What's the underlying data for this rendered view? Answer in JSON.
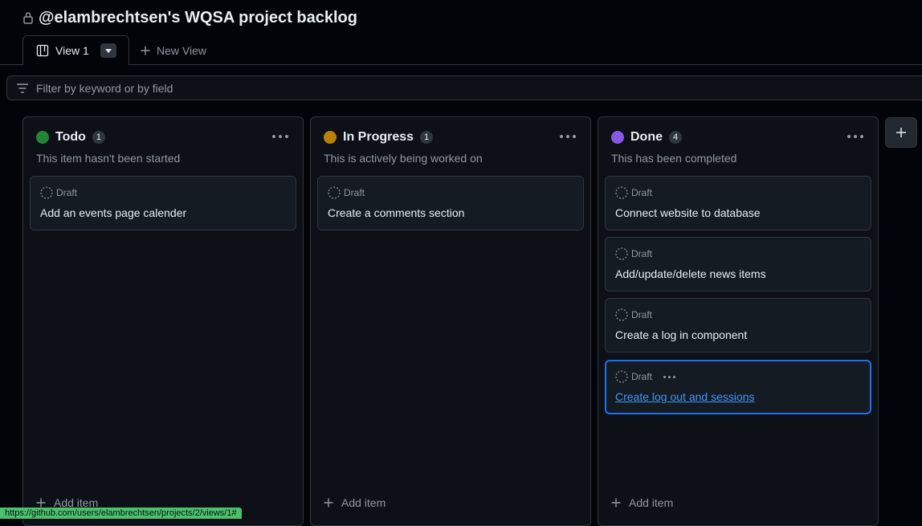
{
  "page": {
    "title": "@elambrechtsen's WQSA project backlog"
  },
  "tabs": {
    "active_label": "View 1",
    "new_view_label": "New View"
  },
  "filter": {
    "placeholder": "Filter by keyword or by field"
  },
  "columns": [
    {
      "name": "Todo",
      "count": "1",
      "color": "#238636",
      "description": "This item hasn't been started",
      "cards": [
        {
          "type": "Draft",
          "title": "Add an events page calender"
        }
      ],
      "add_label": "Add item"
    },
    {
      "name": "In Progress",
      "count": "1",
      "color": "#bb8009",
      "description": "This is actively being worked on",
      "cards": [
        {
          "type": "Draft",
          "title": "Create a comments section"
        }
      ],
      "add_label": "Add item"
    },
    {
      "name": "Done",
      "count": "4",
      "color": "#8957e5",
      "description": "This has been completed",
      "cards": [
        {
          "type": "Draft",
          "title": "Connect website to database"
        },
        {
          "type": "Draft",
          "title": "Add/update/delete news items"
        },
        {
          "type": "Draft",
          "title": "Create a log in component"
        },
        {
          "type": "Draft",
          "title": "Create log out and sessions",
          "focused": true
        }
      ],
      "add_label": "Add item"
    }
  ],
  "status_bar": {
    "url": "https://github.com/users/elambrechtsen/projects/2/views/1#"
  }
}
